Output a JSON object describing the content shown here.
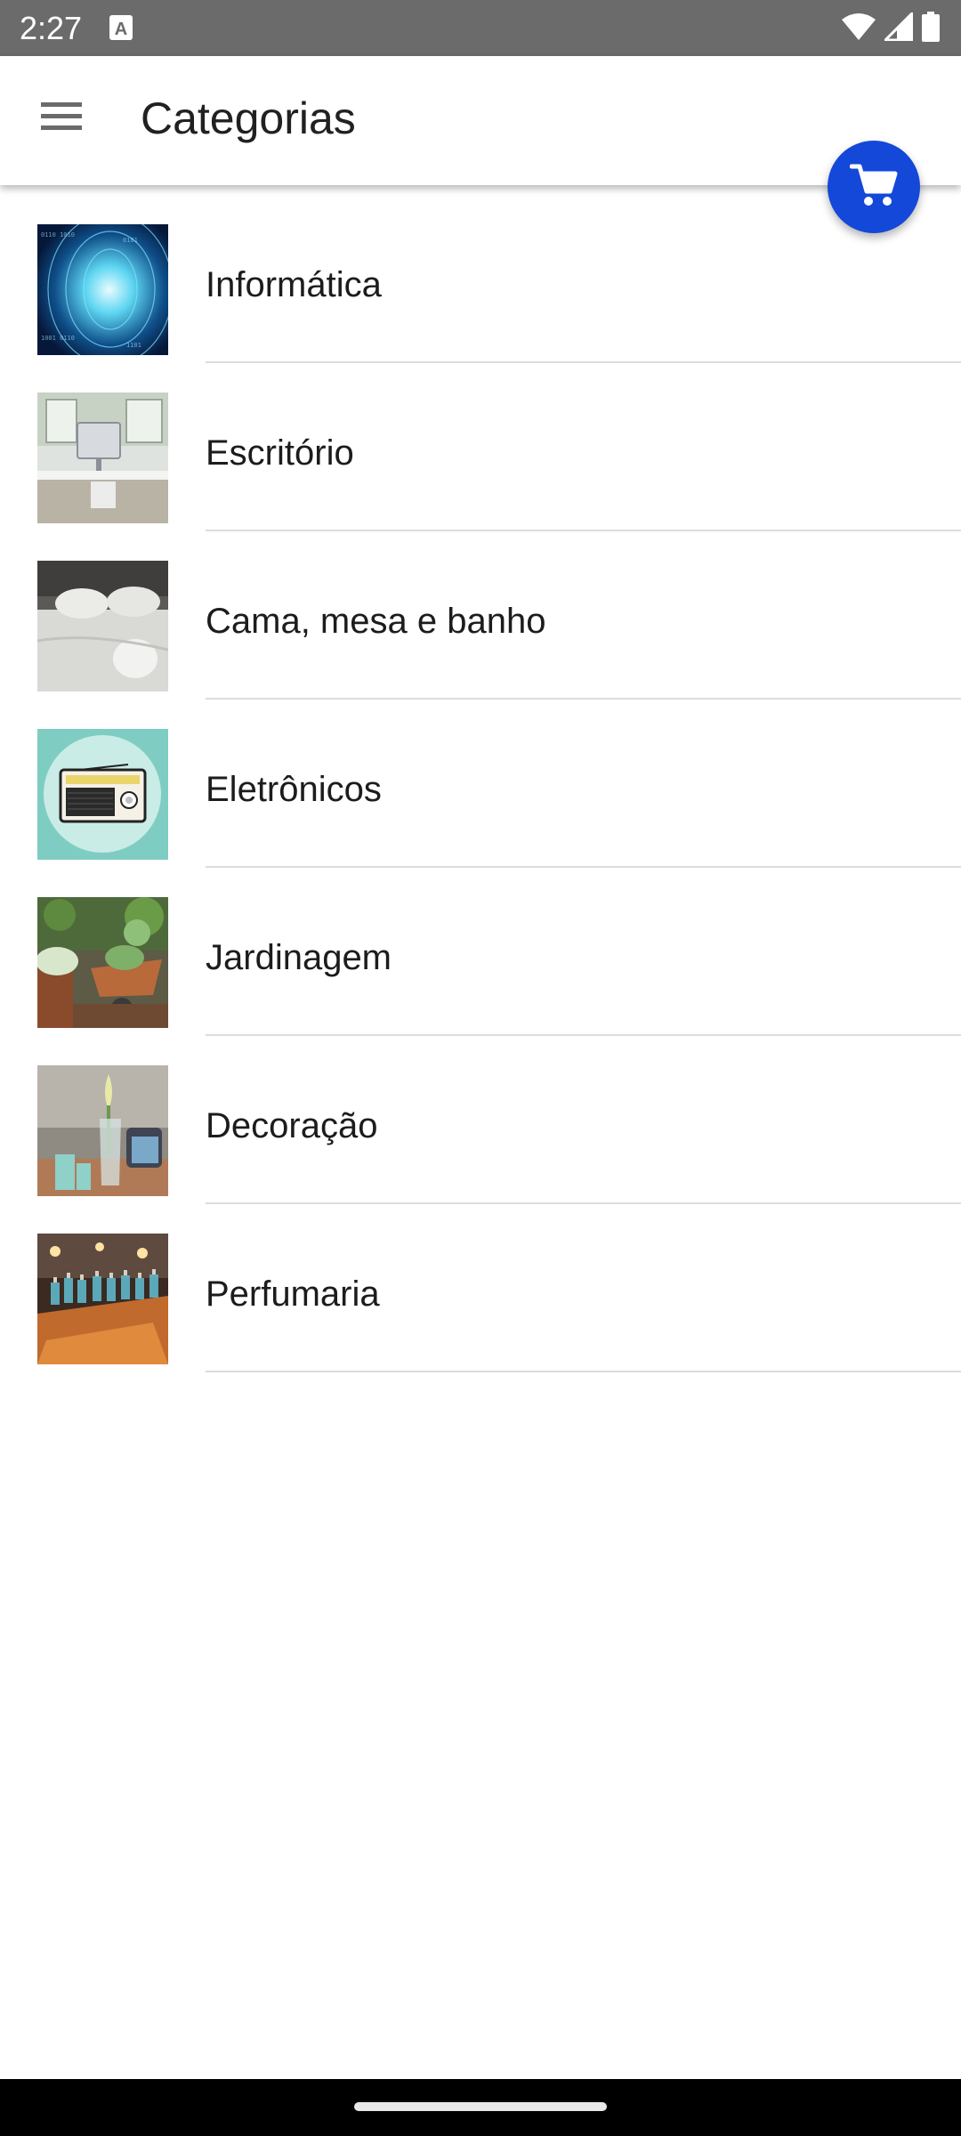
{
  "status_bar": {
    "time": "2:27",
    "notification_icon": "text-a-icon",
    "icons": [
      "wifi-icon",
      "signal-icon",
      "battery-icon"
    ]
  },
  "app_bar": {
    "menu_icon": "hamburger-menu-icon",
    "title": "Categorias"
  },
  "fab": {
    "icon": "shopping-cart-icon",
    "color": "#1348d9"
  },
  "categories": [
    {
      "label": "Informática",
      "image": "digital-tunnel-image"
    },
    {
      "label": "Escritório",
      "image": "office-desk-image"
    },
    {
      "label": "Cama, mesa e banho",
      "image": "bedroom-pillows-image"
    },
    {
      "label": "Eletrônicos",
      "image": "radio-image"
    },
    {
      "label": "Jardinagem",
      "image": "garden-wheelbarrow-image"
    },
    {
      "label": "Decoração",
      "image": "decor-vase-candles-image"
    },
    {
      "label": "Perfumaria",
      "image": "perfume-bottles-image"
    }
  ]
}
